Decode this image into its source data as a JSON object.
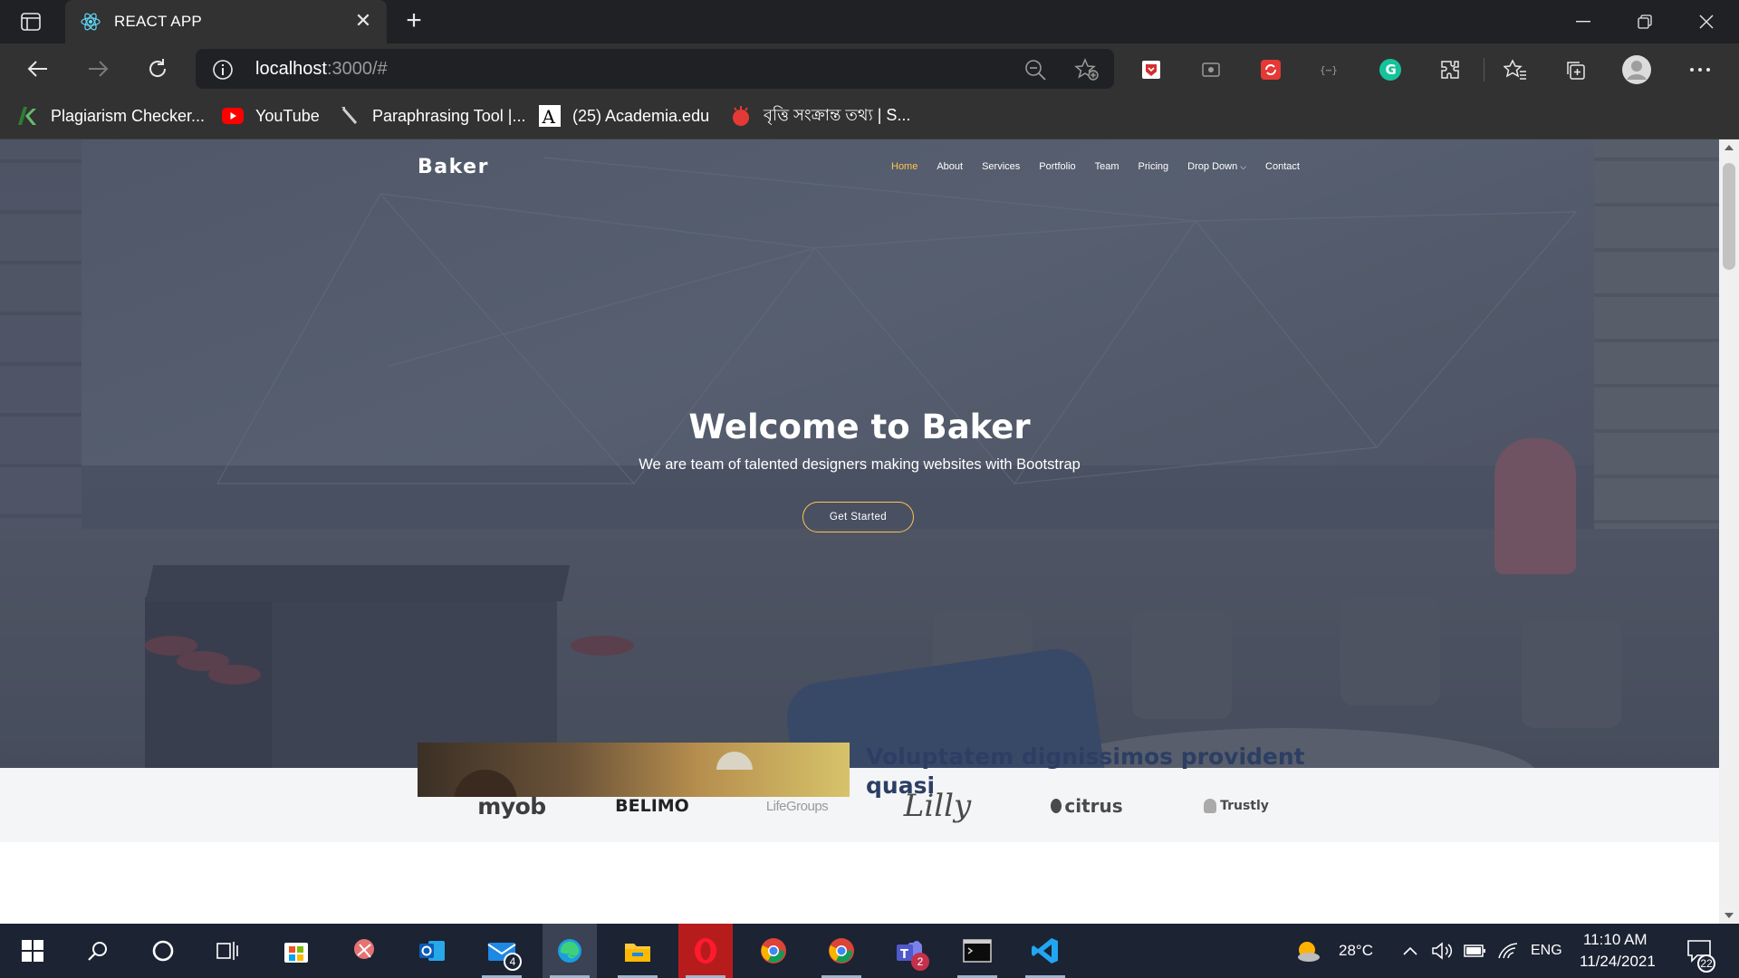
{
  "browser": {
    "tab_title": "REACT APP",
    "tab_close": "✕",
    "new_tab": "+",
    "url_host": "localhost",
    "url_path": ":3000/#",
    "bookmarks": [
      {
        "label": "Plagiarism Checker...",
        "icon": "plagiarism-checker-icon"
      },
      {
        "label": "YouTube",
        "icon": "youtube-icon"
      },
      {
        "label": "Paraphrasing Tool |...",
        "icon": "paraphrasing-tool-icon"
      },
      {
        "label": "(25) Academia.edu",
        "icon": "academia-icon"
      },
      {
        "label": "বৃত্তি সংক্রান্ত তথ্য | S...",
        "icon": "scholarship-info-icon"
      }
    ]
  },
  "site": {
    "logo": "Baker",
    "nav": {
      "home": "Home",
      "about": "About",
      "services": "Services",
      "portfolio": "Portfolio",
      "team": "Team",
      "pricing": "Pricing",
      "dropdown": "Drop Down",
      "contact": "Contact"
    },
    "hero": {
      "title": "Welcome to Baker",
      "subtitle": "We are team of talented designers making websites with Bootstrap",
      "cta": "Get Started"
    },
    "clients": [
      "myob",
      "BELIMO",
      "LifeGroups",
      "Lilly",
      "citrus",
      "Trustly"
    ],
    "about_title": "Voluptatem dignissimos provident quasi"
  },
  "colors": {
    "accent": "#ffc451",
    "about_title": "#2c3e63",
    "taskbar": "#1c2333"
  },
  "taskbar": {
    "weather": "28°C",
    "language": "ENG",
    "time": "11:10 AM",
    "date": "11/24/2021",
    "mail_badge": "4",
    "teams_badge": "2",
    "notifications": "22"
  }
}
